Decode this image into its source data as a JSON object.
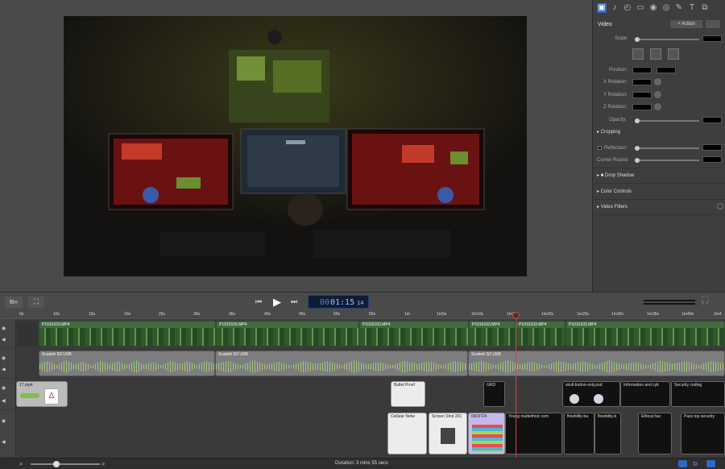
{
  "inspector": {
    "tabs": [
      "video-tab-icon",
      "audio-tab-icon",
      "speed-icon",
      "screen-icon",
      "cursor-icon",
      "annotation-icon",
      "text-icon",
      "filter-icon"
    ],
    "section_title": "Video",
    "action_label": "+ Action",
    "scale_label": "Scale:",
    "position_label": "Position:",
    "xrot_label": "X Rotation:",
    "yrot_label": "Y Rotation:",
    "zrot_label": "Z Rotation:",
    "opacity_label": "Opacity:",
    "cropping_label": "Cropping",
    "reflection_label": "Reflection:",
    "corner_label": "Corner Round:",
    "shadow_label": "Drop Shadow",
    "color_label": "Color Controls",
    "filters_label": "Video Filters"
  },
  "transport": {
    "timecode_main": "01:15",
    "timecode_frames": "14",
    "timecode_prefix": "00"
  },
  "ruler": {
    "ticks": [
      "0s",
      "10s",
      "15s",
      "20s",
      "25s",
      "30s",
      "35s",
      "40s",
      "45s",
      "50s",
      "55s",
      "1m",
      "1m5s",
      "1m10s",
      "1m15s",
      "1m20s",
      "1m25s",
      "1m30s",
      "1m35s",
      "1m40s",
      "1m4"
    ]
  },
  "tracks": {
    "video_clips": [
      "P1010103.MP4",
      "P1010103.MP4",
      "P1010103.MP4",
      "P1010103.MP4",
      "P1010103.MP4",
      "P1010103.MP4"
    ],
    "audio_clips": [
      "Scarlett 2i2 USB",
      "Scarlett 2i2 USB",
      "Scarlett 2i2 USB"
    ],
    "track3": {
      "left_clip": "17.mp4",
      "bullet": "Bullet Proof",
      "grd": "GRD",
      "skull": "skull-button-only.psd",
      "info": "Information and cyb",
      "security": "Security coding"
    },
    "track4": {
      "cell": "Cellular Netw",
      "screenshot": "Screen Shot 201",
      "num": "6819724",
      "young": "Young multiethnic com",
      "flow1": "flowbility-ba",
      "flow2": "flowbility-b",
      "ethical": "Ethical hac",
      "pass": "Pass top security"
    }
  },
  "status": {
    "duration": "Duration: 3 mins 55 secs"
  }
}
